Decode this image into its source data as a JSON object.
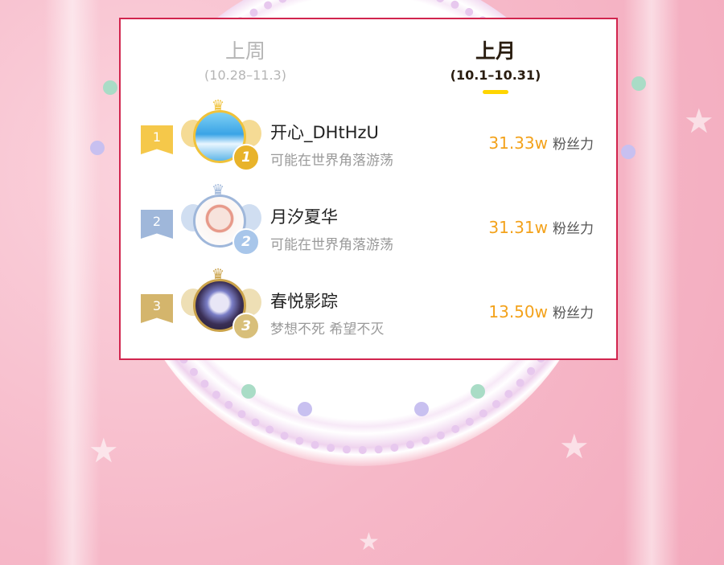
{
  "tabs": [
    {
      "title": "上周",
      "range": "(10.28–11.3)",
      "active": false
    },
    {
      "title": "上月",
      "range": "(10.1–10.31)",
      "active": true
    }
  ],
  "ranking": [
    {
      "rank": "1",
      "name": "开心_DHtHzU",
      "motto": "可能在世界角落游荡",
      "score": "31.33w",
      "score_unit": "粉丝力",
      "medal": "1",
      "flag_color": "#f5c84a",
      "medal_color": "#e8b32a"
    },
    {
      "rank": "2",
      "name": "月汐夏华",
      "motto": "可能在世界角落游荡",
      "score": "31.31w",
      "score_unit": "粉丝力",
      "medal": "2",
      "flag_color": "#9fb7da",
      "medal_color": "#a8c6ea"
    },
    {
      "rank": "3",
      "name": "春悦影踪",
      "motto": "梦想不死   希望不灭",
      "score": "13.50w",
      "score_unit": "粉丝力",
      "medal": "3",
      "flag_color": "#d4b56c",
      "medal_color": "#d8bf7a"
    }
  ]
}
